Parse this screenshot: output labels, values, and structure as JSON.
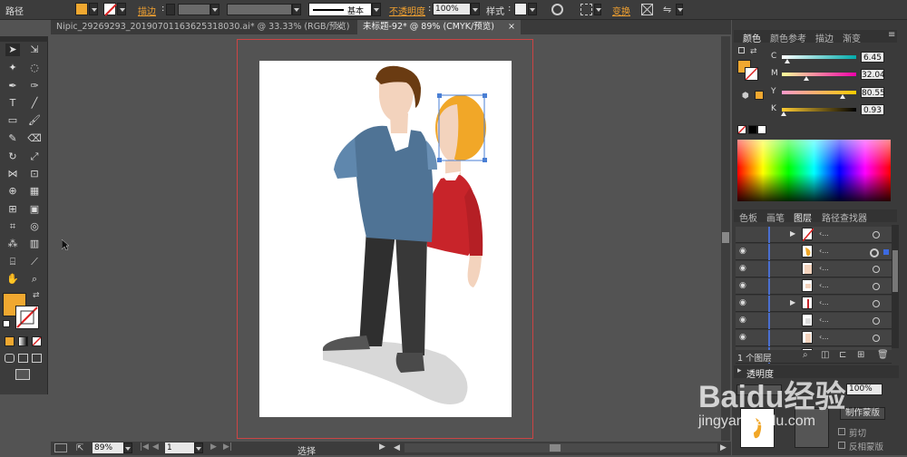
{
  "control_bar": {
    "object_type": "路径",
    "stroke_label": "描边",
    "stroke_style": "基本",
    "opacity_label": "不透明度",
    "opacity_value": "100%",
    "style_label": "样式",
    "transform_label": "变换",
    "fill_color": "#f0a830"
  },
  "tabs": [
    {
      "label": "Nipic_29269293_20190701163625318030.ai* @ 33.33% (RGB/预览)"
    },
    {
      "label": "未标题-92* @ 89% (CMYK/预览)"
    }
  ],
  "color_panel": {
    "tabs": [
      "颜色",
      "颜色参考",
      "描边",
      "渐变"
    ],
    "channels": [
      {
        "name": "C",
        "value": "6.45",
        "pos": 0.06,
        "grad": "linear-gradient(to right,#fff,#0aa)"
      },
      {
        "name": "M",
        "value": "32.04",
        "pos": 0.32,
        "grad": "linear-gradient(to right,#ff9,#e0a)"
      },
      {
        "name": "Y",
        "value": "80.55",
        "pos": 0.81,
        "grad": "linear-gradient(to right,#f9c,#fc0)"
      },
      {
        "name": "K",
        "value": "0.93",
        "pos": 0.01,
        "grad": "linear-gradient(to right,#fc3,#000)"
      }
    ]
  },
  "layers_panel": {
    "tabs": [
      "色板",
      "画笔",
      "图层",
      "路径查找器"
    ],
    "footer": "1 个图层"
  },
  "transparency_panel": {
    "title": "透明度",
    "opacity_value": "100%",
    "make_mask": "制作蒙版",
    "clip": "剪切",
    "invert": "反相蒙版"
  },
  "status_bar": {
    "zoom": "89%",
    "page": "1",
    "tool": "选择"
  },
  "watermark": {
    "brand": "Baidu经验",
    "url": "jingyan.baidu.com"
  }
}
